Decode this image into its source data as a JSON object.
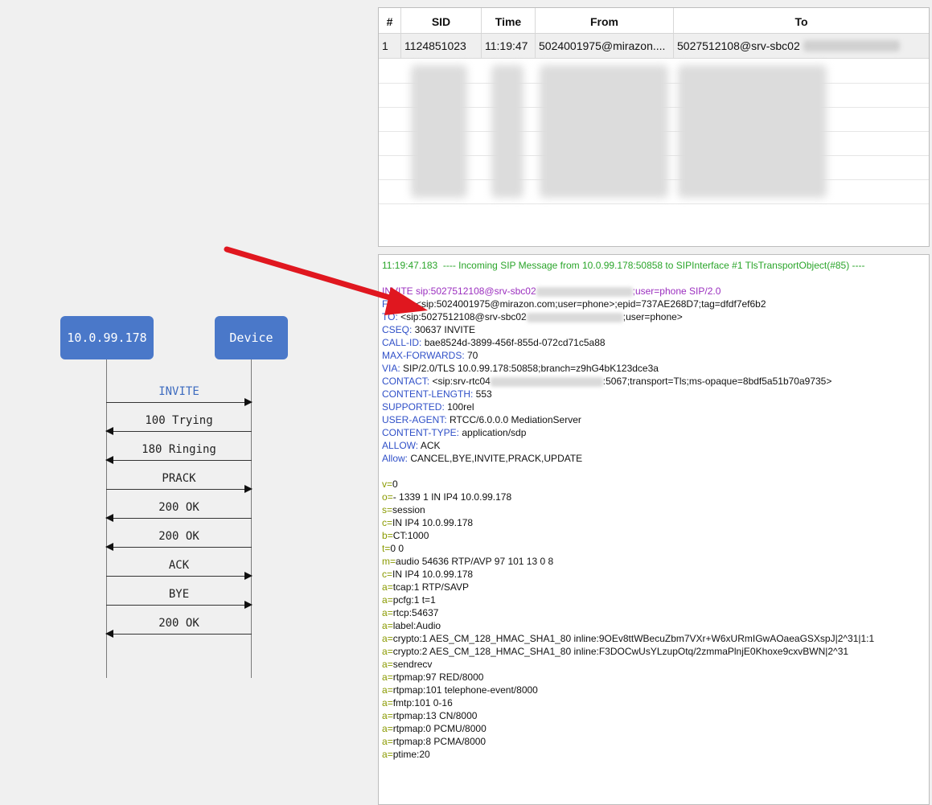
{
  "ladder": {
    "left_node": "10.0.99.178",
    "right_node": "Device",
    "messages": [
      {
        "label": "INVITE",
        "dir": "right",
        "highlight": true
      },
      {
        "label": "100 Trying",
        "dir": "left",
        "highlight": false
      },
      {
        "label": "180 Ringing",
        "dir": "left",
        "highlight": false
      },
      {
        "label": "PRACK",
        "dir": "right",
        "highlight": false
      },
      {
        "label": "200 OK",
        "dir": "left",
        "highlight": false
      },
      {
        "label": "200 OK",
        "dir": "left",
        "highlight": false
      },
      {
        "label": "ACK",
        "dir": "right",
        "highlight": false
      },
      {
        "label": "BYE",
        "dir": "right",
        "highlight": false
      },
      {
        "label": "200 OK",
        "dir": "left",
        "highlight": false
      }
    ]
  },
  "table": {
    "headers": {
      "num": "#",
      "sid": "SID",
      "time": "Time",
      "from": "From",
      "to": "To"
    },
    "row": {
      "num": "1",
      "sid": "1124851023",
      "time": "11:19:47",
      "from": "5024001975@mirazon....",
      "to": "5027512108@srv-sbc02"
    }
  },
  "sip": {
    "banner": "11:19:47.183  ---- Incoming SIP Message from 10.0.99.178:50858 to SIPInterface #1 TlsTransportObject(#85) ----",
    "request_start": "INVITE sip:5027512108@srv-sbc02",
    "request_end": ";user=phone SIP/2.0",
    "from_name": "FROM:",
    "from_value": " <sip:5024001975@mirazon.com;user=phone>;epid=737AE268D7;tag=dfdf7ef6b2",
    "to_name": "TO:",
    "to_value_start": " <sip:5027512108@srv-sbc02",
    "to_value_end": ";user=phone>",
    "cseq_name": "CSEQ:",
    "cseq_value": " 30637 INVITE",
    "callid_name": "CALL-ID:",
    "callid_value": " bae8524d-3899-456f-855d-072cd71c5a88",
    "maxfwd_name": "MAX-FORWARDS:",
    "maxfwd_value": " 70",
    "via_name": "VIA:",
    "via_value": " SIP/2.0/TLS 10.0.99.178:50858;branch=z9hG4bK123dce3a",
    "contact_name": "CONTACT:",
    "contact_value_start": " <sip:srv-rtc04",
    "contact_value_end": ":5067;transport=Tls;ms-opaque=8bdf5a51b70a9735>",
    "clen_name": "CONTENT-LENGTH:",
    "clen_value": " 553",
    "supported_name": "SUPPORTED:",
    "supported_value": " 100rel",
    "ua_name": "USER-AGENT:",
    "ua_value": " RTCC/6.0.0.0 MediationServer",
    "ctype_name": "CONTENT-TYPE:",
    "ctype_value": " application/sdp",
    "allow_name": "ALLOW:",
    "allow_value": " ACK",
    "allow2_name": "Allow:",
    "allow2_value": " CANCEL,BYE,INVITE,PRACK,UPDATE",
    "sdp": [
      {
        "k": "v",
        "v": "0"
      },
      {
        "k": "o",
        "v": "- 1339 1 IN IP4 10.0.99.178"
      },
      {
        "k": "s",
        "v": "session"
      },
      {
        "k": "c",
        "v": "IN IP4 10.0.99.178"
      },
      {
        "k": "b",
        "v": "CT:1000"
      },
      {
        "k": "t",
        "v": "0 0"
      },
      {
        "k": "m",
        "v": "audio 54636 RTP/AVP 97 101 13 0 8"
      },
      {
        "k": "c",
        "v": "IN IP4 10.0.99.178"
      },
      {
        "k": "a",
        "v": "tcap:1 RTP/SAVP"
      },
      {
        "k": "a",
        "v": "pcfg:1 t=1"
      },
      {
        "k": "a",
        "v": "rtcp:54637"
      },
      {
        "k": "a",
        "v": "label:Audio"
      },
      {
        "k": "a",
        "v": "crypto:1 AES_CM_128_HMAC_SHA1_80 inline:9OEv8ttWBecuZbm7VXr+W6xURmIGwAOaeaGSXspJ|2^31|1:1"
      },
      {
        "k": "a",
        "v": "crypto:2 AES_CM_128_HMAC_SHA1_80 inline:F3DOCwUsYLzupOtq/2zmmaPlnjE0Khoxe9cxvBWN|2^31"
      },
      {
        "k": "a",
        "v": "sendrecv"
      },
      {
        "k": "a",
        "v": "rtpmap:97 RED/8000"
      },
      {
        "k": "a",
        "v": "rtpmap:101 telephone-event/8000"
      },
      {
        "k": "a",
        "v": "fmtp:101 0-16"
      },
      {
        "k": "a",
        "v": "rtpmap:13 CN/8000"
      },
      {
        "k": "a",
        "v": "rtpmap:0 PCMU/8000"
      },
      {
        "k": "a",
        "v": "rtpmap:8 PCMA/8000"
      },
      {
        "k": "a",
        "v": "ptime:20"
      }
    ]
  },
  "colors": {
    "node": "#4a78c9",
    "annotation_arrow": "#e0171f",
    "banner": "#2aa52a",
    "request_line": "#9b2fbf",
    "header_name": "#3050c8"
  }
}
